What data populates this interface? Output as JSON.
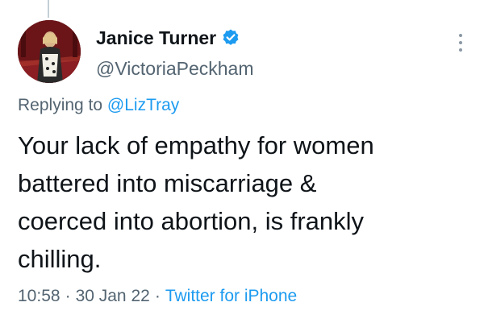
{
  "author": {
    "display_name": "Janice Turner",
    "handle": "@VictoriaPeckham",
    "verified": true,
    "avatar_icon": "profile-photo"
  },
  "reply": {
    "prefix": "Replying to",
    "mention": "@LizTray"
  },
  "tweet": {
    "text": "Your lack of empathy for women\nbattered into miscarriage &\ncoerced into abortion, is frankly\nchilling."
  },
  "meta": {
    "time": "10:58",
    "separator": "·",
    "date": "30 Jan 22",
    "source": "Twitter for iPhone"
  },
  "colors": {
    "text_primary": "#0f1419",
    "text_secondary": "#536471",
    "accent": "#1d9bf0"
  }
}
